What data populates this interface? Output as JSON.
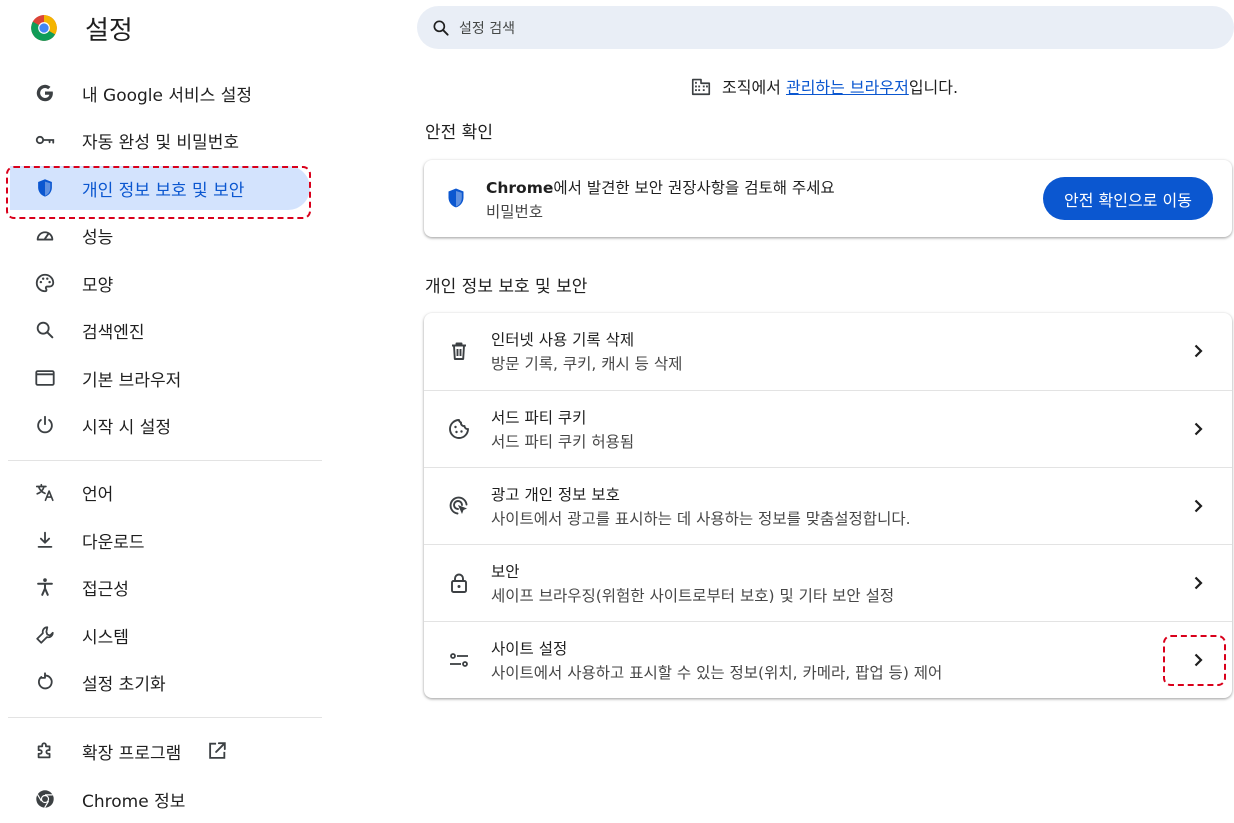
{
  "app": {
    "title": "설정",
    "logo_icon": "chrome-logo-icon"
  },
  "search": {
    "placeholder": "설정 검색",
    "icon": "search-icon"
  },
  "sidebar": {
    "active_index": 2,
    "items": [
      {
        "label": "내 Google 서비스 설정",
        "icon": "google-g-icon"
      },
      {
        "label": "자동 완성 및 비밀번호",
        "icon": "key-icon"
      },
      {
        "label": "개인 정보 보호 및 보안",
        "icon": "shield-icon"
      },
      {
        "label": "성능",
        "icon": "speedometer-icon"
      },
      {
        "label": "모양",
        "icon": "palette-icon"
      },
      {
        "label": "검색엔진",
        "icon": "search-icon"
      },
      {
        "label": "기본 브라우저",
        "icon": "browser-window-icon"
      },
      {
        "label": "시작 시 설정",
        "icon": "power-icon"
      },
      {
        "label": "언어",
        "icon": "translate-icon"
      },
      {
        "label": "다운로드",
        "icon": "download-icon"
      },
      {
        "label": "접근성",
        "icon": "accessibility-icon"
      },
      {
        "label": "시스템",
        "icon": "wrench-icon"
      },
      {
        "label": "설정 초기화",
        "icon": "reset-icon"
      },
      {
        "label": "확장 프로그램",
        "icon": "extension-icon"
      },
      {
        "label": "Chrome 정보",
        "icon": "chrome-info-icon"
      }
    ]
  },
  "managed_notice": {
    "prefix": "조직에서 ",
    "link": "관리하는 브라우저",
    "suffix": "입니다.",
    "icon": "building-icon"
  },
  "safety_check": {
    "section_title": "안전 확인",
    "title_brand": "Chrome",
    "title_rest": "에서 발견한 보안 권장사항을 검토해 주세요",
    "subtitle": "비밀번호",
    "button": "안전 확인으로 이동",
    "icon": "shield-icon"
  },
  "privacy": {
    "section_title": "개인 정보 보호 및 보안",
    "rows": [
      {
        "title": "인터넷 사용 기록 삭제",
        "subtitle": "방문 기록, 쿠키, 캐시 등 삭제",
        "icon": "trash-icon"
      },
      {
        "title": "서드 파티 쿠키",
        "subtitle": "서드 파티 쿠키 허용됨",
        "icon": "cookie-icon"
      },
      {
        "title": "광고 개인 정보 보호",
        "subtitle": "사이트에서 광고를 표시하는 데 사용하는 정보를 맞춤설정합니다.",
        "icon": "ad-privacy-icon"
      },
      {
        "title": "보안",
        "subtitle": "세이프 브라우징(위험한 사이트로부터 보호) 및 기타 보안 설정",
        "icon": "lock-icon"
      },
      {
        "title": "사이트 설정",
        "subtitle": "사이트에서 사용하고 표시할 수 있는 정보(위치, 카메라, 팝업 등) 제어",
        "icon": "tune-icon"
      }
    ]
  },
  "colors": {
    "accent": "#0b57d0",
    "active_bg": "#d3e3fd",
    "search_bg": "#e9eef6",
    "highlight": "#d9001b"
  }
}
